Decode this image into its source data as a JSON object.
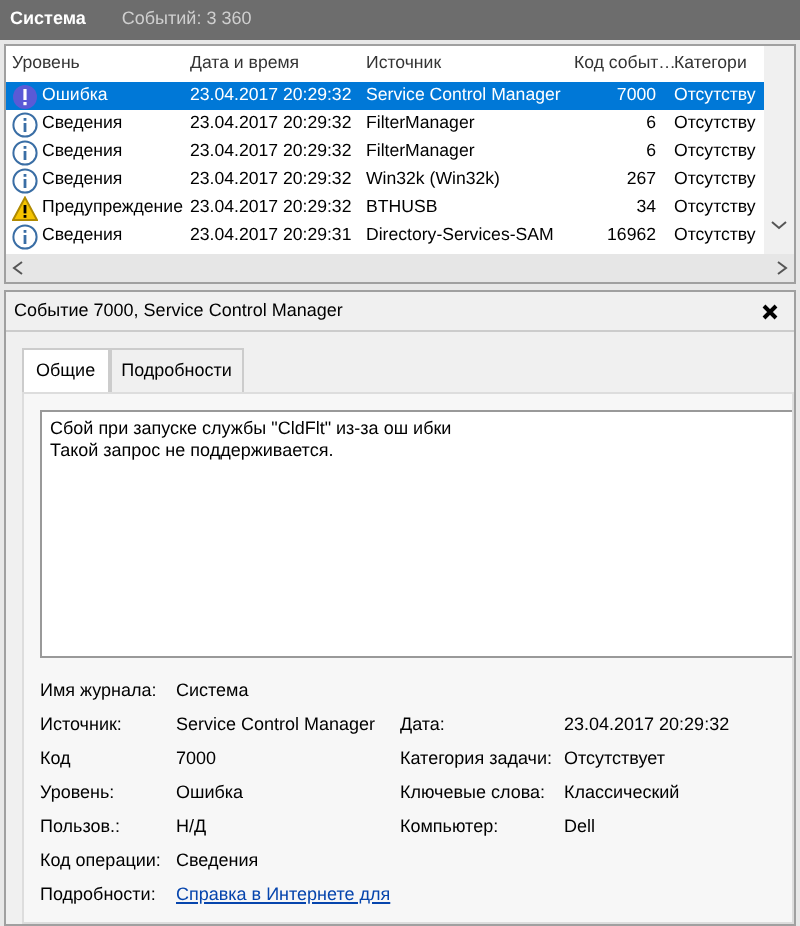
{
  "header": {
    "title": "Система",
    "count": "Событий: 3 360"
  },
  "table": {
    "columns": [
      "Уровень",
      "Дата и время",
      "Источник",
      "Код событ…",
      "Категори"
    ],
    "rows": [
      {
        "kind": "error",
        "selected": true,
        "cells": [
          "Ошибка",
          "23.04.2017 20:29:32",
          "Service Control Manager",
          "7000",
          "Отсутству"
        ]
      },
      {
        "kind": "info",
        "selected": false,
        "cells": [
          "Сведения",
          "23.04.2017 20:29:32",
          "FilterManager",
          "6",
          "Отсутству"
        ]
      },
      {
        "kind": "info",
        "selected": false,
        "cells": [
          "Сведения",
          "23.04.2017 20:29:32",
          "FilterManager",
          "6",
          "Отсутству"
        ]
      },
      {
        "kind": "info",
        "selected": false,
        "cells": [
          "Сведения",
          "23.04.2017 20:29:32",
          "Win32k (Win32k)",
          "267",
          "Отсутству"
        ]
      },
      {
        "kind": "warning",
        "selected": false,
        "cells": [
          "Предупреждение",
          "23.04.2017 20:29:32",
          "BTHUSB",
          "34",
          "Отсутству"
        ]
      },
      {
        "kind": "info",
        "selected": false,
        "cells": [
          "Сведения",
          "23.04.2017 20:29:31",
          "Directory-Services-SAM",
          "16962",
          "Отсутству"
        ]
      }
    ]
  },
  "detail": {
    "title": "Событие 7000, Service Control Manager",
    "tabs": [
      {
        "label": "Общие",
        "selected": true
      },
      {
        "label": "Подробности",
        "selected": false
      }
    ],
    "message": [
      "Сбой при запуске службы \"CldFlt\" из-за ош ибки",
      "Такой запрос не поддерживается."
    ],
    "fields": [
      {
        "left": {
          "label": "Имя журнала:",
          "value": "Система"
        }
      },
      {
        "left": {
          "label": "Источник:",
          "value": "Service Control Manager"
        },
        "right": {
          "label": "Дата:",
          "value": "23.04.2017 20:29:32"
        }
      },
      {
        "left": {
          "label": "Код",
          "value": "7000"
        },
        "right": {
          "label": "Категория задачи:",
          "value": "Отсутствует"
        }
      },
      {
        "left": {
          "label": "Уровень:",
          "value": "Ошибка"
        },
        "right": {
          "label": "Ключевые слова:",
          "value": "Классический"
        }
      },
      {
        "left": {
          "label": "Пользов.:",
          "value": "Н/Д"
        },
        "right": {
          "label": "Компьютер:",
          "value": "Dell"
        }
      },
      {
        "left": {
          "label": "Код операции:",
          "value": "Сведения"
        }
      },
      {
        "left": {
          "label": "Подробности:",
          "value": "Справка в Интернете для",
          "kind": "link"
        }
      }
    ]
  }
}
